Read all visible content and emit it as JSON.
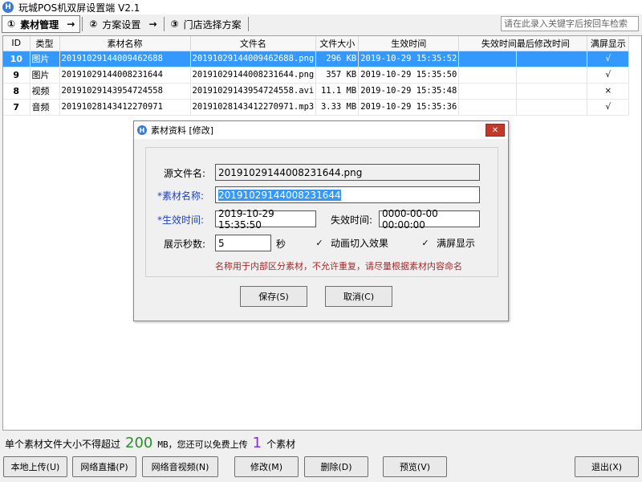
{
  "window": {
    "title": "玩城POS机双屏设置端 V2.1",
    "icon_letter": "H"
  },
  "steps": [
    {
      "num": "①",
      "label": "素材管理",
      "arrow": "→"
    },
    {
      "num": "②",
      "label": "方案设置",
      "arrow": "→"
    },
    {
      "num": "③",
      "label": "门店选择方案"
    }
  ],
  "search": {
    "placeholder": "请在此录入关键字后按回车检索"
  },
  "table": {
    "headers": [
      "ID",
      "类型",
      "素材名称",
      "文件名",
      "文件大小",
      "生效时间",
      "失效时间",
      "最后修改时间",
      "满屏显示"
    ],
    "rows": [
      {
        "id": "10",
        "type": "图片",
        "name": "20191029144009462688",
        "file": "20191029144009462688.png",
        "size": "296 KB",
        "start": "2019-10-29 15:35:52",
        "end": "",
        "modified": "",
        "full": "√"
      },
      {
        "id": "9",
        "type": "图片",
        "name": "20191029144008231644",
        "file": "20191029144008231644.png",
        "size": "357 KB",
        "start": "2019-10-29 15:35:50",
        "end": "",
        "modified": "",
        "full": "√"
      },
      {
        "id": "8",
        "type": "视频",
        "name": "20191029143954724558",
        "file": "20191029143954724558.avi",
        "size": "11.1 MB",
        "start": "2019-10-29 15:35:48",
        "end": "",
        "modified": "",
        "full": "×"
      },
      {
        "id": "7",
        "type": "音频",
        "name": "20191028143412270971",
        "file": "20191028143412270971.mp3",
        "size": "3.33 MB",
        "start": "2019-10-29 15:35:36",
        "end": "",
        "modified": "",
        "full": "√"
      }
    ]
  },
  "info": {
    "prefix": "单个素材文件大小不得超过",
    "max_size": "200",
    "unit": "MB，您还可以免费上传",
    "remaining": "1",
    "suffix": "个素材"
  },
  "buttons": {
    "local_upload": "本地上传(U)",
    "live": "网络直播(P)",
    "net_av": "网络音视频(N)",
    "modify": "修改(M)",
    "delete": "删除(D)",
    "preview": "预览(V)",
    "exit": "退出(X)"
  },
  "dialog": {
    "title": "素材资料 [修改]",
    "close": "✕",
    "source_label": "源文件名:",
    "source_value": "20191029144008231644.png",
    "name_label": "*素材名称:",
    "name_value": "20191029144008231644",
    "start_label": "*生效时间:",
    "start_value": "2019-10-29 15:35:50",
    "end_label": "失效时间:",
    "end_value": "0000-00-00 00:00:00",
    "seconds_label": "展示秒数:",
    "seconds_value": "5",
    "seconds_unit": "秒",
    "anim_check": "✓",
    "anim_label": "动画切入效果",
    "full_check": "✓",
    "full_label": "满屏显示",
    "warning": "名称用于内部区分素材，不允许重复，请尽量根据素材内容命名",
    "save": "保存(S)",
    "cancel": "取消(C)"
  }
}
